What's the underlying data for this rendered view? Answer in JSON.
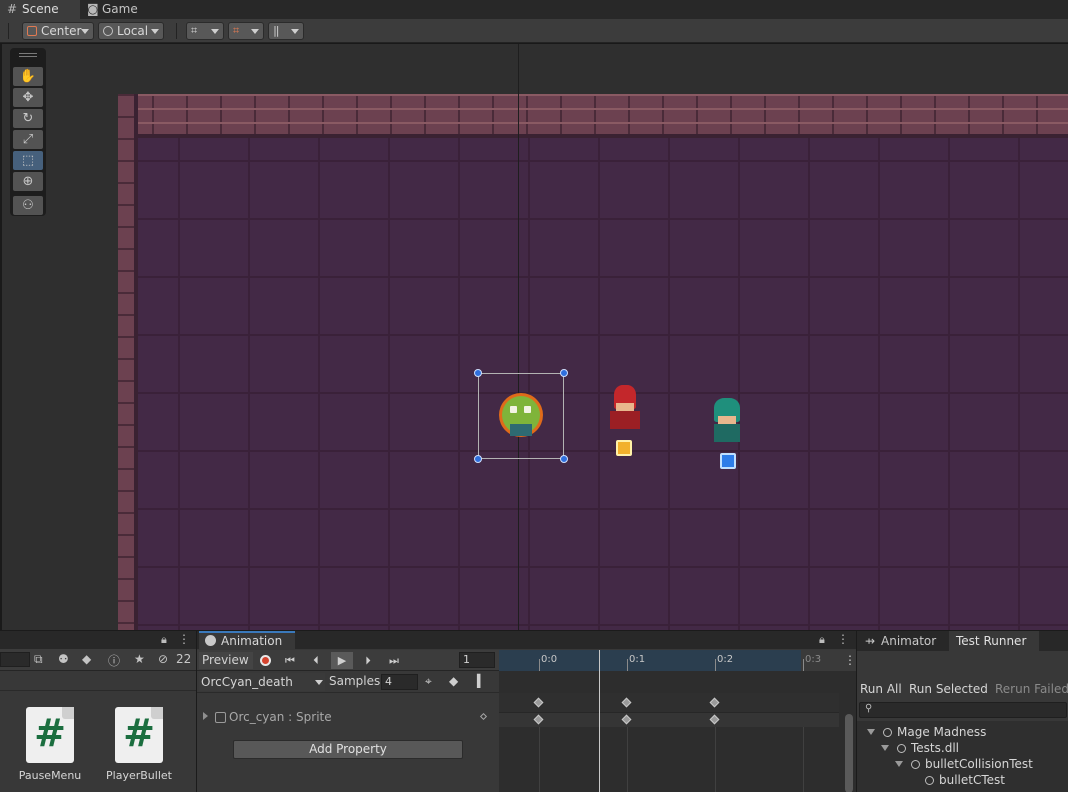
{
  "tabs": {
    "scene": "Scene",
    "game": "Game"
  },
  "scene_toolbar": {
    "pivot_mode": "Center",
    "pivot_rotation": "Local"
  },
  "project": {
    "hidden_count": "22",
    "assets": [
      {
        "name": "PauseMenu",
        "icon": "csharp-script-icon"
      },
      {
        "name": "PlayerBullet",
        "icon": "csharp-script-icon"
      }
    ]
  },
  "animation": {
    "tab_label": "Animation",
    "preview_label": "Preview",
    "frame": "1",
    "clip": "OrcCyan_death",
    "samples_label": "Samples",
    "samples": "4",
    "property": "Orc_cyan : Sprite",
    "add_property": "Add Property",
    "ruler": [
      "0:0",
      "0:1",
      "0:2",
      "0:3"
    ]
  },
  "right_panel": {
    "tab_animator": "Animator",
    "tab_test_runner": "Test Runner",
    "run_all": "Run All",
    "run_selected": "Run Selected",
    "rerun_failed": "Rerun Failed",
    "tree": [
      {
        "label": "Mage Madness",
        "depth": 0
      },
      {
        "label": "Tests.dll",
        "depth": 1
      },
      {
        "label": "bulletCollisionTest",
        "depth": 2
      },
      {
        "label": "bulletCTest",
        "depth": 3
      }
    ]
  },
  "colors": {
    "accent": "#3a79bb",
    "selection_handle": "#2f6fdd",
    "dungeon_floor": "#432946",
    "record": "#d4432e"
  }
}
